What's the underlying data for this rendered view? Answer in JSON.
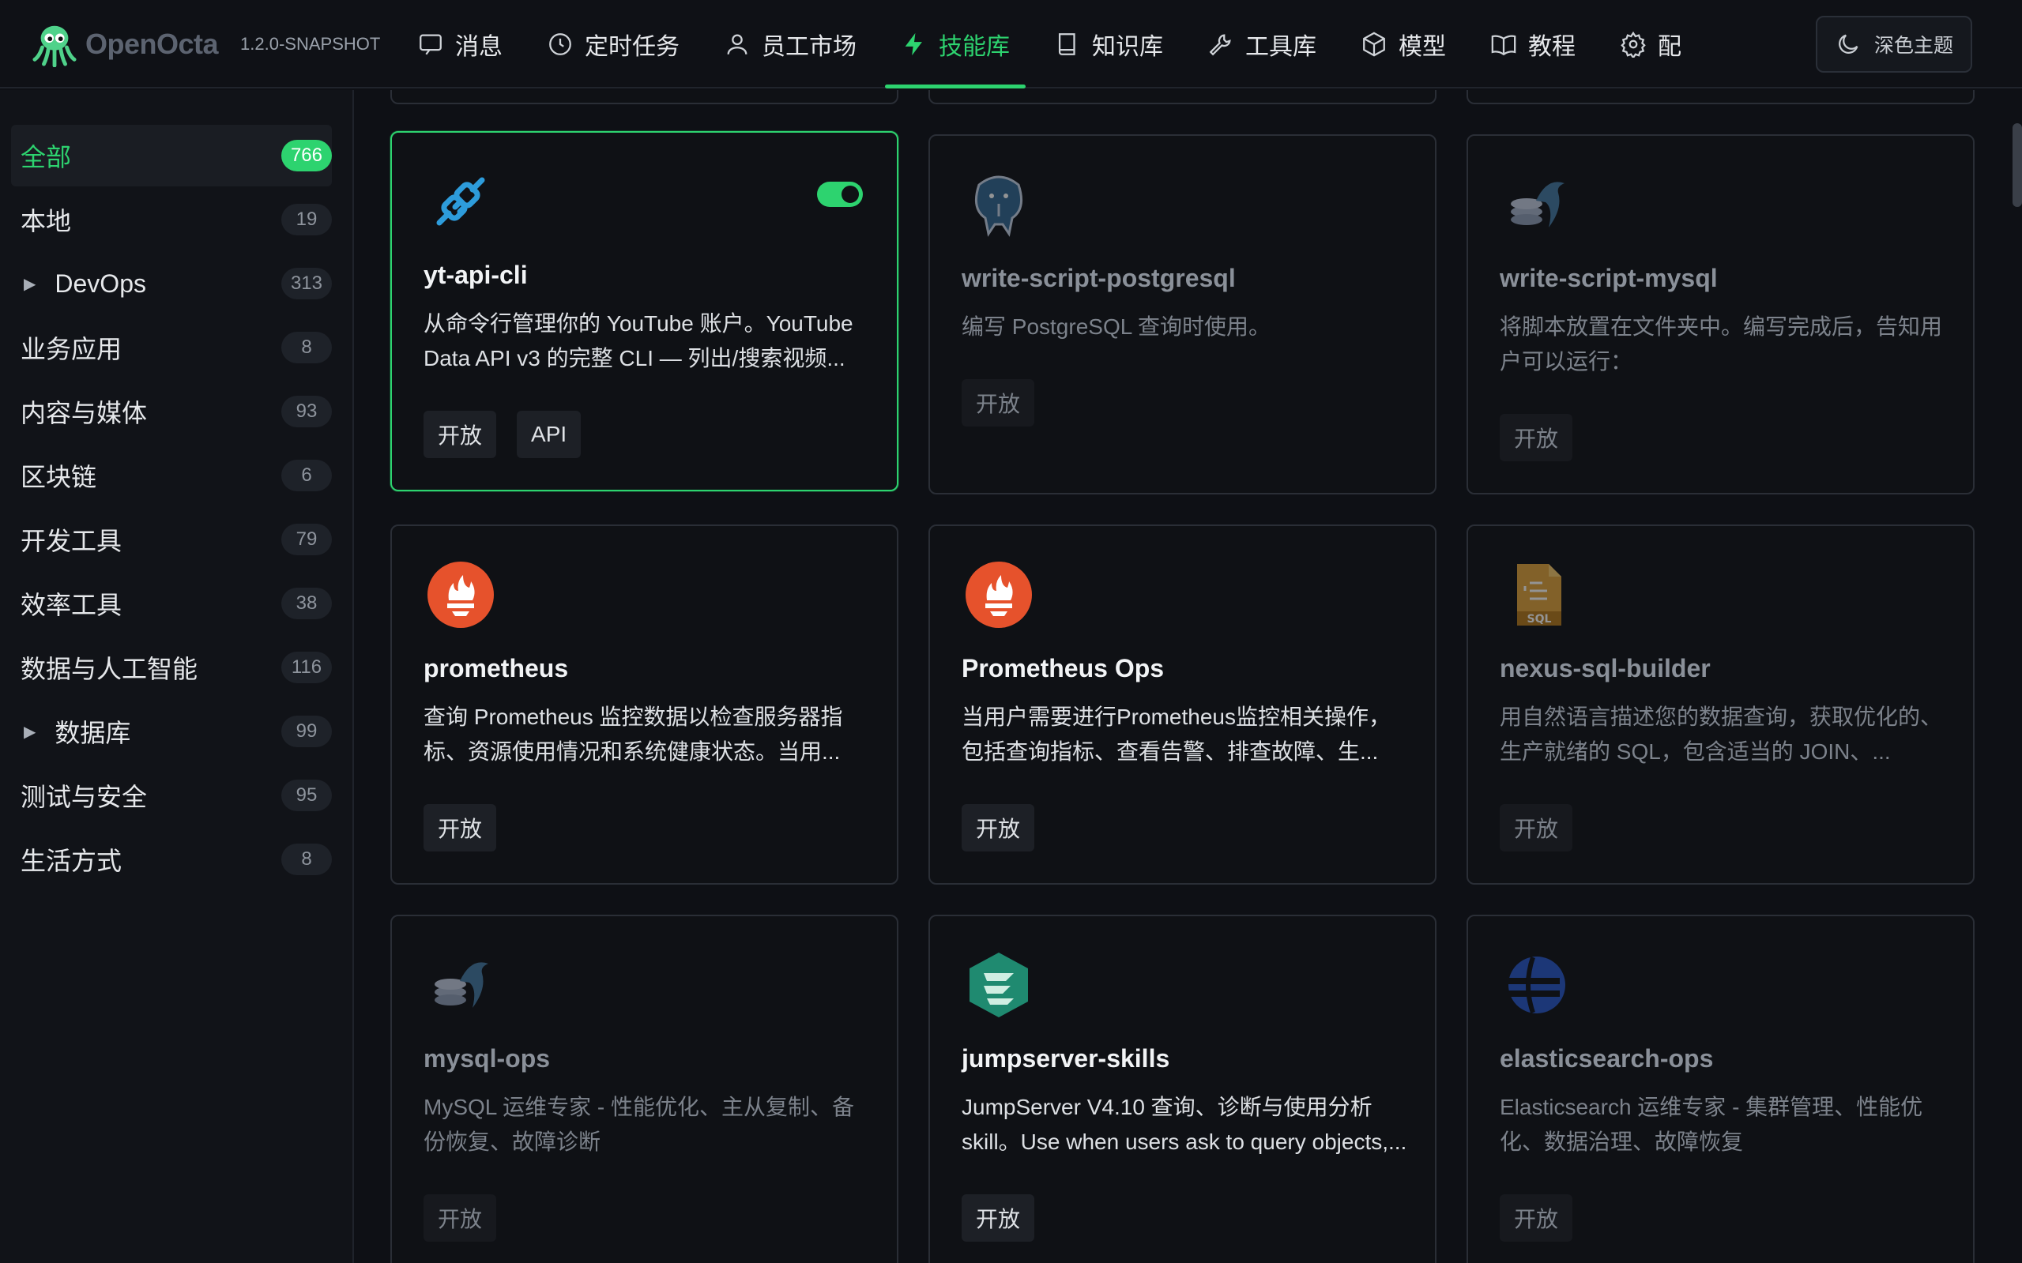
{
  "brand": {
    "name": "OpenOcta",
    "version": "1.2.0-SNAPSHOT"
  },
  "nav": {
    "items": [
      {
        "label": "消息",
        "icon": "message-icon"
      },
      {
        "label": "定时任务",
        "icon": "clock-icon"
      },
      {
        "label": "员工市场",
        "icon": "user-icon"
      },
      {
        "label": "技能库",
        "icon": "lightning-icon",
        "active": true
      },
      {
        "label": "知识库",
        "icon": "book-icon"
      },
      {
        "label": "工具库",
        "icon": "wrench-icon"
      },
      {
        "label": "模型",
        "icon": "cube-icon"
      },
      {
        "label": "教程",
        "icon": "open-book-icon"
      },
      {
        "label": "配",
        "icon": "gear-icon"
      }
    ],
    "theme_label": "深色主题"
  },
  "sidebar": {
    "items": [
      {
        "label": "全部",
        "count": "766"
      },
      {
        "label": "本地",
        "count": "19"
      },
      {
        "label": "DevOps",
        "count": "313"
      },
      {
        "label": "业务应用",
        "count": "8"
      },
      {
        "label": "内容与媒体",
        "count": "93"
      },
      {
        "label": "区块链",
        "count": "6"
      },
      {
        "label": "开发工具",
        "count": "79"
      },
      {
        "label": "效率工具",
        "count": "38"
      },
      {
        "label": "数据与人工智能",
        "count": "116"
      },
      {
        "label": "数据库",
        "count": "99"
      },
      {
        "label": "测试与安全",
        "count": "95"
      },
      {
        "label": "生活方式",
        "count": "8"
      }
    ]
  },
  "cards": [
    {
      "title": "yt-api-cli",
      "desc": "从命令行管理你的 YouTube 账户。YouTube Data API v3 的完整 CLI — 列出/搜索视频...",
      "tags": [
        "开放",
        "API"
      ],
      "icon": "plug-icon",
      "enabled": true
    },
    {
      "title": "write-script-postgresql",
      "desc": "编写 PostgreSQL 查询时使用。",
      "tags": [
        "开放"
      ],
      "icon": "postgresql-elephant-icon"
    },
    {
      "title": "write-script-mysql",
      "desc": "将脚本放置在文件夹中。编写完成后，告知用户可以运行：",
      "tags": [
        "开放"
      ],
      "icon": "mysql-dolphin-icon"
    },
    {
      "title": "prometheus",
      "desc": "查询 Prometheus 监控数据以检查服务器指标、资源使用情况和系统健康状态。当用...",
      "tags": [
        "开放"
      ],
      "icon": "prometheus-flame-icon"
    },
    {
      "title": "Prometheus Ops",
      "desc": "当用户需要进行Prometheus监控相关操作，包括查询指标、查看告警、排查故障、生...",
      "tags": [
        "开放"
      ],
      "icon": "prometheus-flame-icon"
    },
    {
      "title": "nexus-sql-builder",
      "desc": "用自然语言描述您的数据查询，获取优化的、生产就绪的 SQL，包含适当的 JOIN、...",
      "tags": [
        "开放"
      ],
      "icon": "sql-file-icon"
    },
    {
      "title": "mysql-ops",
      "desc": "MySQL 运维专家 - 性能优化、主从复制、备份恢复、故障诊断",
      "tags": [
        "开放"
      ],
      "icon": "mysql-dolphin-icon"
    },
    {
      "title": "jumpserver-skills",
      "desc": "JumpServer V4.10 查询、诊断与使用分析 skill。Use when users ask to query objects,...",
      "tags": [
        "开放"
      ],
      "icon": "jumpserver-icon"
    },
    {
      "title": "elasticsearch-ops",
      "desc": "Elasticsearch 运维专家 - 集群管理、性能优化、数据治理、故障恢复",
      "tags": [
        "开放"
      ],
      "icon": "elasticsearch-icon"
    }
  ],
  "colors": {
    "accent": "#2dd36f",
    "prometheus": "#e6522c",
    "mysql": "#4479a1"
  }
}
